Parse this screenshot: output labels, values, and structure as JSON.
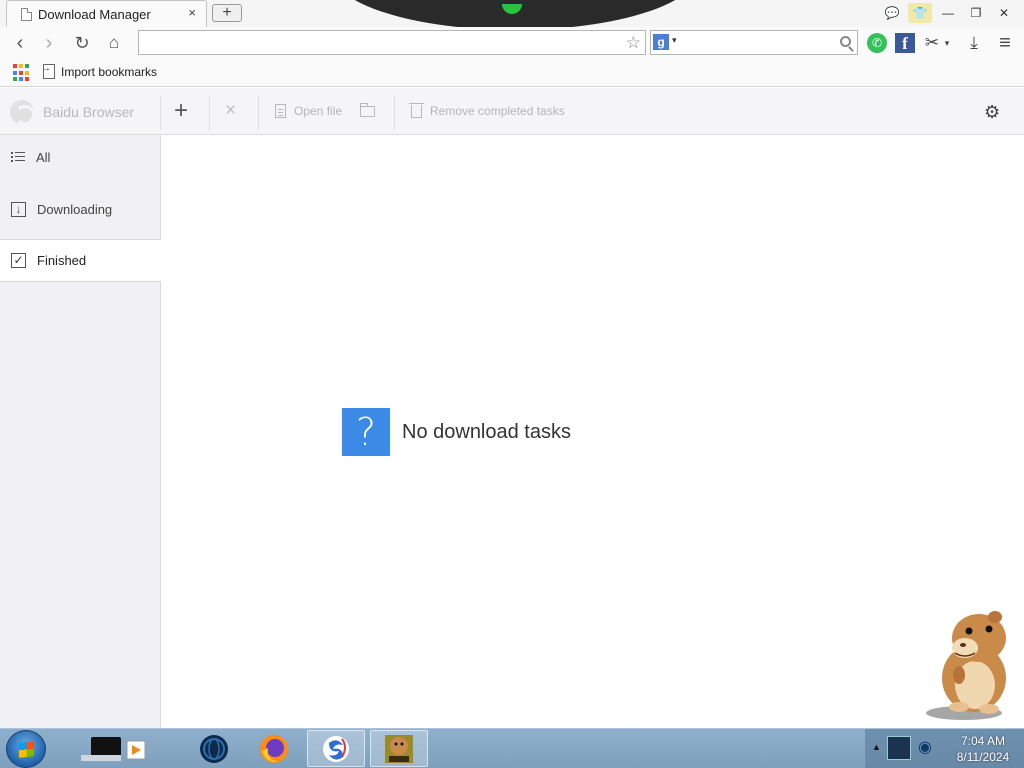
{
  "tab": {
    "title": "Download Manager",
    "close_glyph": "×",
    "new_tab_glyph": "+"
  },
  "toolbar": {
    "back_icon": "back-arrow-icon",
    "forward_icon": "forward-arrow-icon",
    "reload_icon": "reload-icon",
    "home_icon": "home-icon",
    "address": {
      "value": "",
      "placeholder": ""
    },
    "search": {
      "value": "",
      "placeholder": ""
    }
  },
  "bookmarks": {
    "items": [
      {
        "label": "Import bookmarks"
      }
    ]
  },
  "apps_colors": [
    "#e94235",
    "#fbbc05",
    "#34a853",
    "#4285f4",
    "#e94235",
    "#fbbc05",
    "#34a853",
    "#4285f4",
    "#e94235"
  ],
  "dm": {
    "brand": "Baidu Browser",
    "add_glyph": "+",
    "delete_glyph": "×",
    "open_file": "Open file",
    "remove_completed": "Remove completed tasks",
    "gear_glyph": "⚙"
  },
  "sidebar": {
    "items": [
      {
        "label": "All"
      },
      {
        "label": "Downloading"
      },
      {
        "label": "Finished",
        "selected": true
      }
    ]
  },
  "main": {
    "empty_icon": "?",
    "empty_text": "No download tasks"
  },
  "clock": {
    "time": "7:04 AM",
    "date": "8/11/2024"
  },
  "colors": {
    "accent": "#3b8ae6",
    "sidebar_bg": "#f0f0f5",
    "taskbar": "#8fb0cc"
  }
}
